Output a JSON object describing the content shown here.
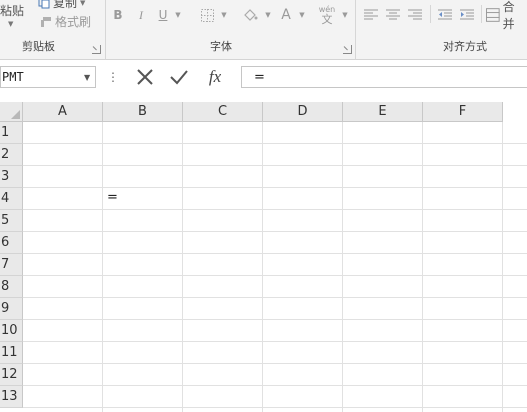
{
  "ribbon": {
    "clipboard": {
      "paste_label": "粘贴",
      "copy_label": "复制",
      "format_painter_label": "格式刷",
      "group_label": "剪贴板"
    },
    "font": {
      "bold": "B",
      "italic": "I",
      "underline": "U",
      "font_color_letter": "A",
      "phonetic_top": "wén",
      "phonetic_bottom": "文",
      "group_label": "字体"
    },
    "alignment": {
      "merge_label": "合并",
      "group_label": "对齐方式"
    }
  },
  "formula_bar": {
    "name_box": "PMT",
    "fx_label": "fx",
    "formula": "="
  },
  "sheet": {
    "columns": [
      "A",
      "B",
      "C",
      "D",
      "E",
      "F"
    ],
    "rows": [
      "1",
      "2",
      "3",
      "4",
      "5",
      "6",
      "7",
      "8",
      "9",
      "10",
      "11",
      "12",
      "13"
    ],
    "active_cell": {
      "ref": "B4",
      "value": "="
    }
  },
  "colors": {
    "ribbon_bg": "#f3f3f3",
    "header_bg": "#e9e9e9",
    "gridline": "#e1e1e1",
    "disabled_icon": "#9a9a9a"
  }
}
